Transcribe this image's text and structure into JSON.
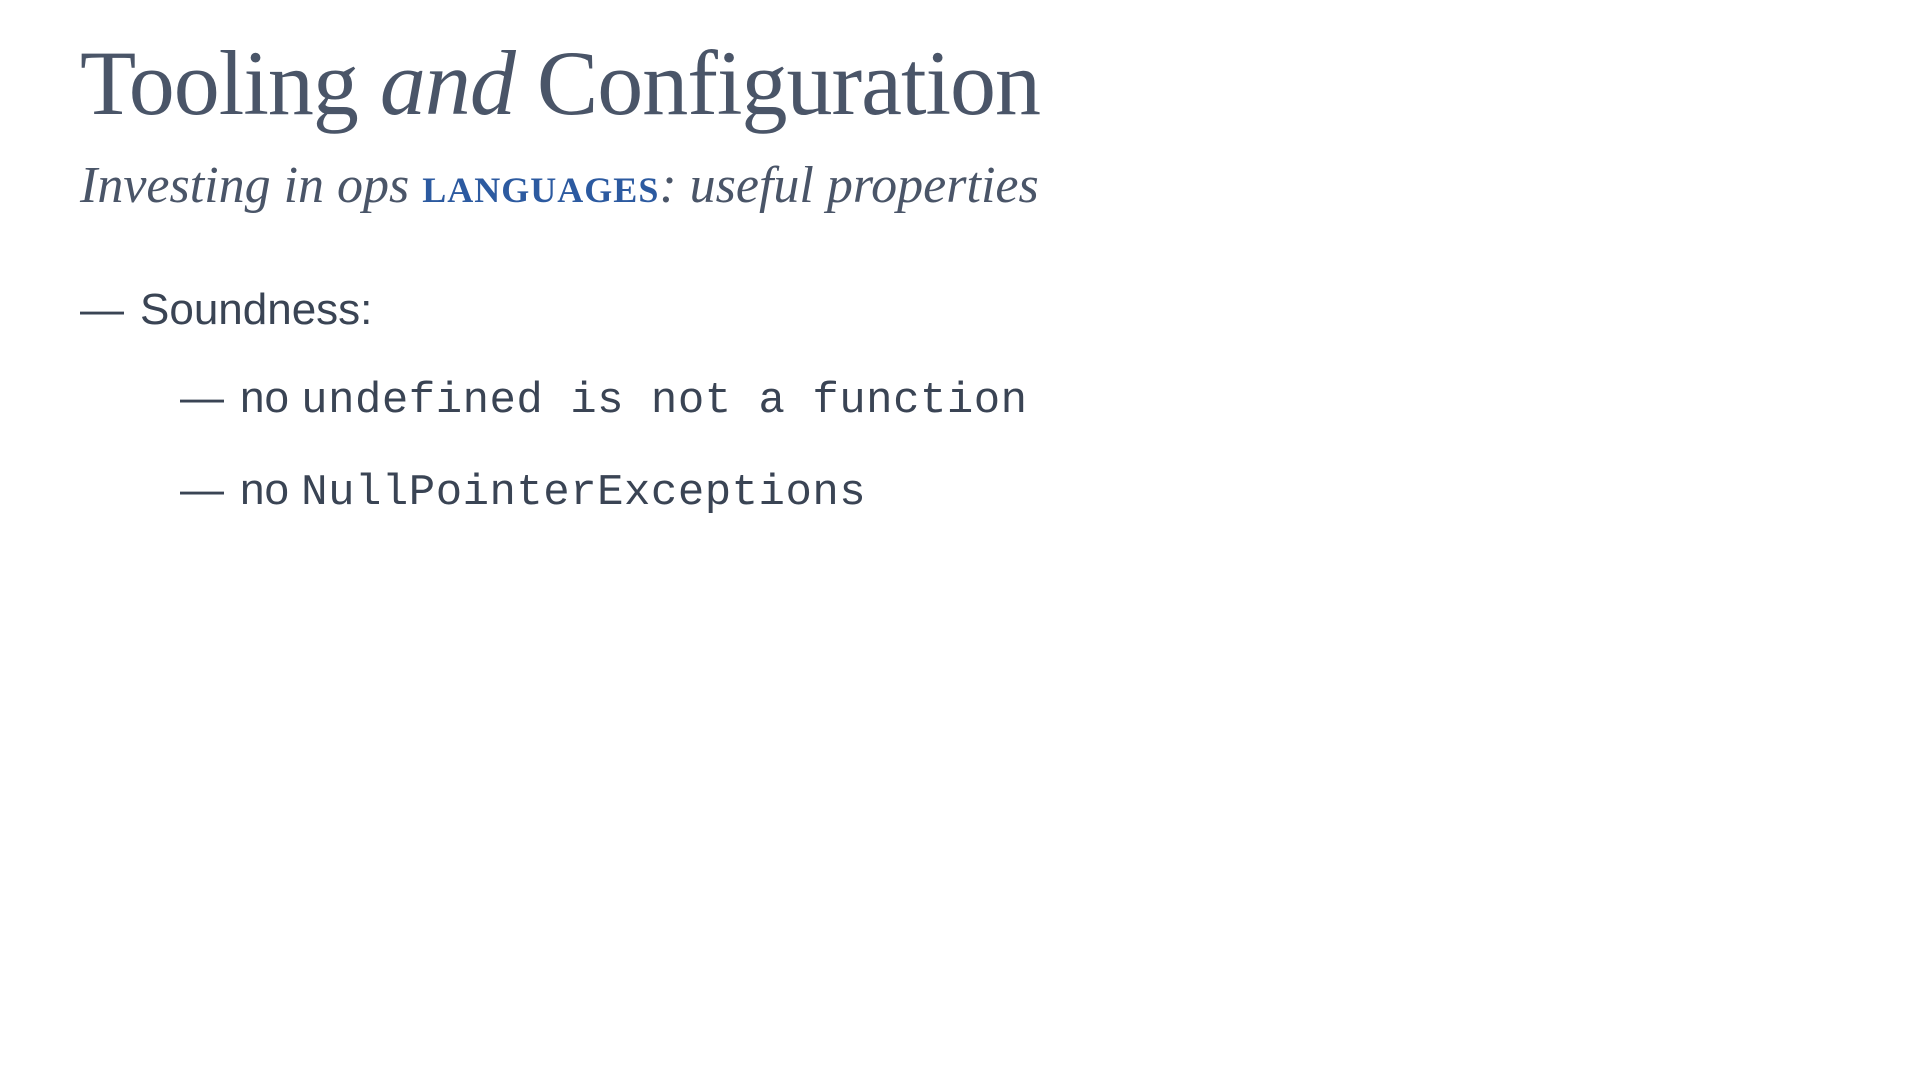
{
  "title": {
    "part1": "Tooling ",
    "italic": "and",
    "part2": " Configuration"
  },
  "subtitle": {
    "part1": "Investing in ops ",
    "smallcaps": "LANGUAGES",
    "part2": ": useful properties"
  },
  "bullets": {
    "l1": "Soundness:",
    "l2_1_prefix": "no ",
    "l2_1_mono": "undefined is not a function",
    "l2_2_prefix": "no ",
    "l2_2_mono": "NullPointerExceptions"
  },
  "dash": "—"
}
